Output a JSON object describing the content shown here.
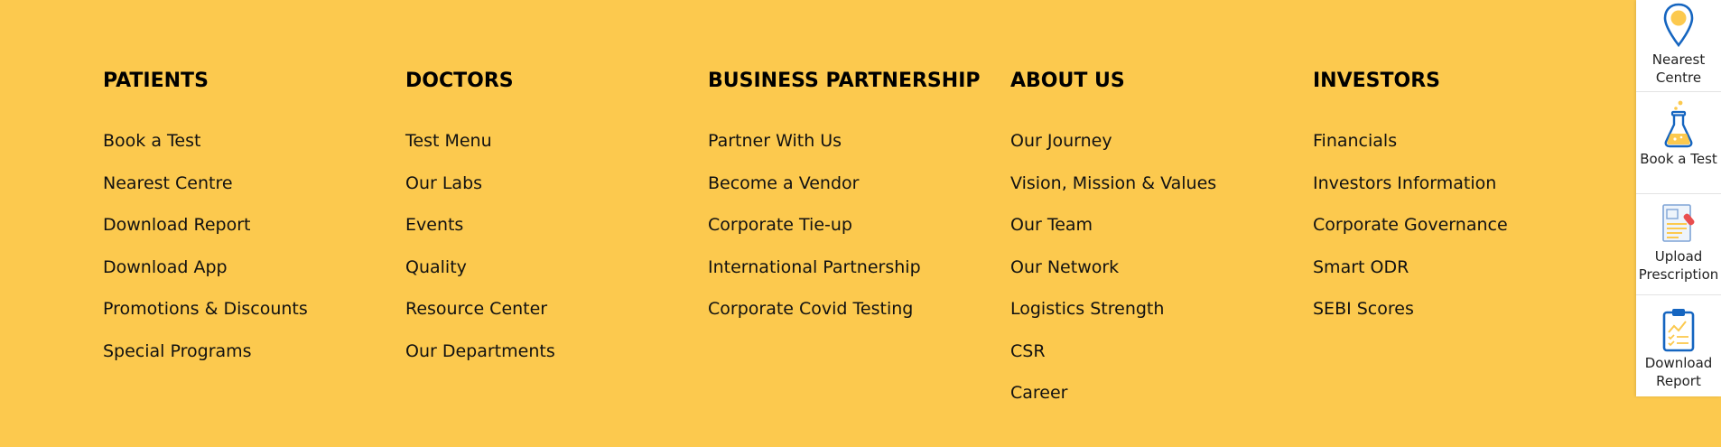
{
  "footer": {
    "columns": [
      {
        "heading": "PATIENTS",
        "links": [
          "Book a Test",
          "Nearest Centre",
          "Download Report",
          "Download App",
          "Promotions & Discounts",
          "Special Programs"
        ]
      },
      {
        "heading": "DOCTORS",
        "links": [
          "Test Menu",
          "Our Labs",
          "Events",
          "Quality",
          "Resource Center",
          "Our Departments"
        ]
      },
      {
        "heading": "BUSINESS PARTNERSHIP",
        "links": [
          "Partner With Us",
          "Become a Vendor",
          "Corporate Tie-up",
          "International Partnership",
          "Corporate Covid Testing"
        ]
      },
      {
        "heading": "ABOUT US",
        "links": [
          "Our Journey",
          "Vision, Mission & Values",
          "Our Team",
          "Our Network",
          "Logistics Strength",
          "CSR",
          "Career"
        ]
      },
      {
        "heading": "INVESTORS",
        "links": [
          "Financials",
          "Investors Information",
          "Corporate Governance",
          "Smart ODR",
          "SEBI Scores"
        ]
      }
    ]
  },
  "quick_links": [
    {
      "label": "Nearest Centre",
      "icon": "location-pin-icon"
    },
    {
      "label": "Book a Test",
      "icon": "flask-icon"
    },
    {
      "label": "Upload Prescription",
      "icon": "prescription-icon"
    },
    {
      "label": "Download Report",
      "icon": "clipboard-report-icon"
    }
  ],
  "colors": {
    "background": "#fcc94e",
    "accent_blue": "#1565c0",
    "panel": "#ffffff"
  }
}
